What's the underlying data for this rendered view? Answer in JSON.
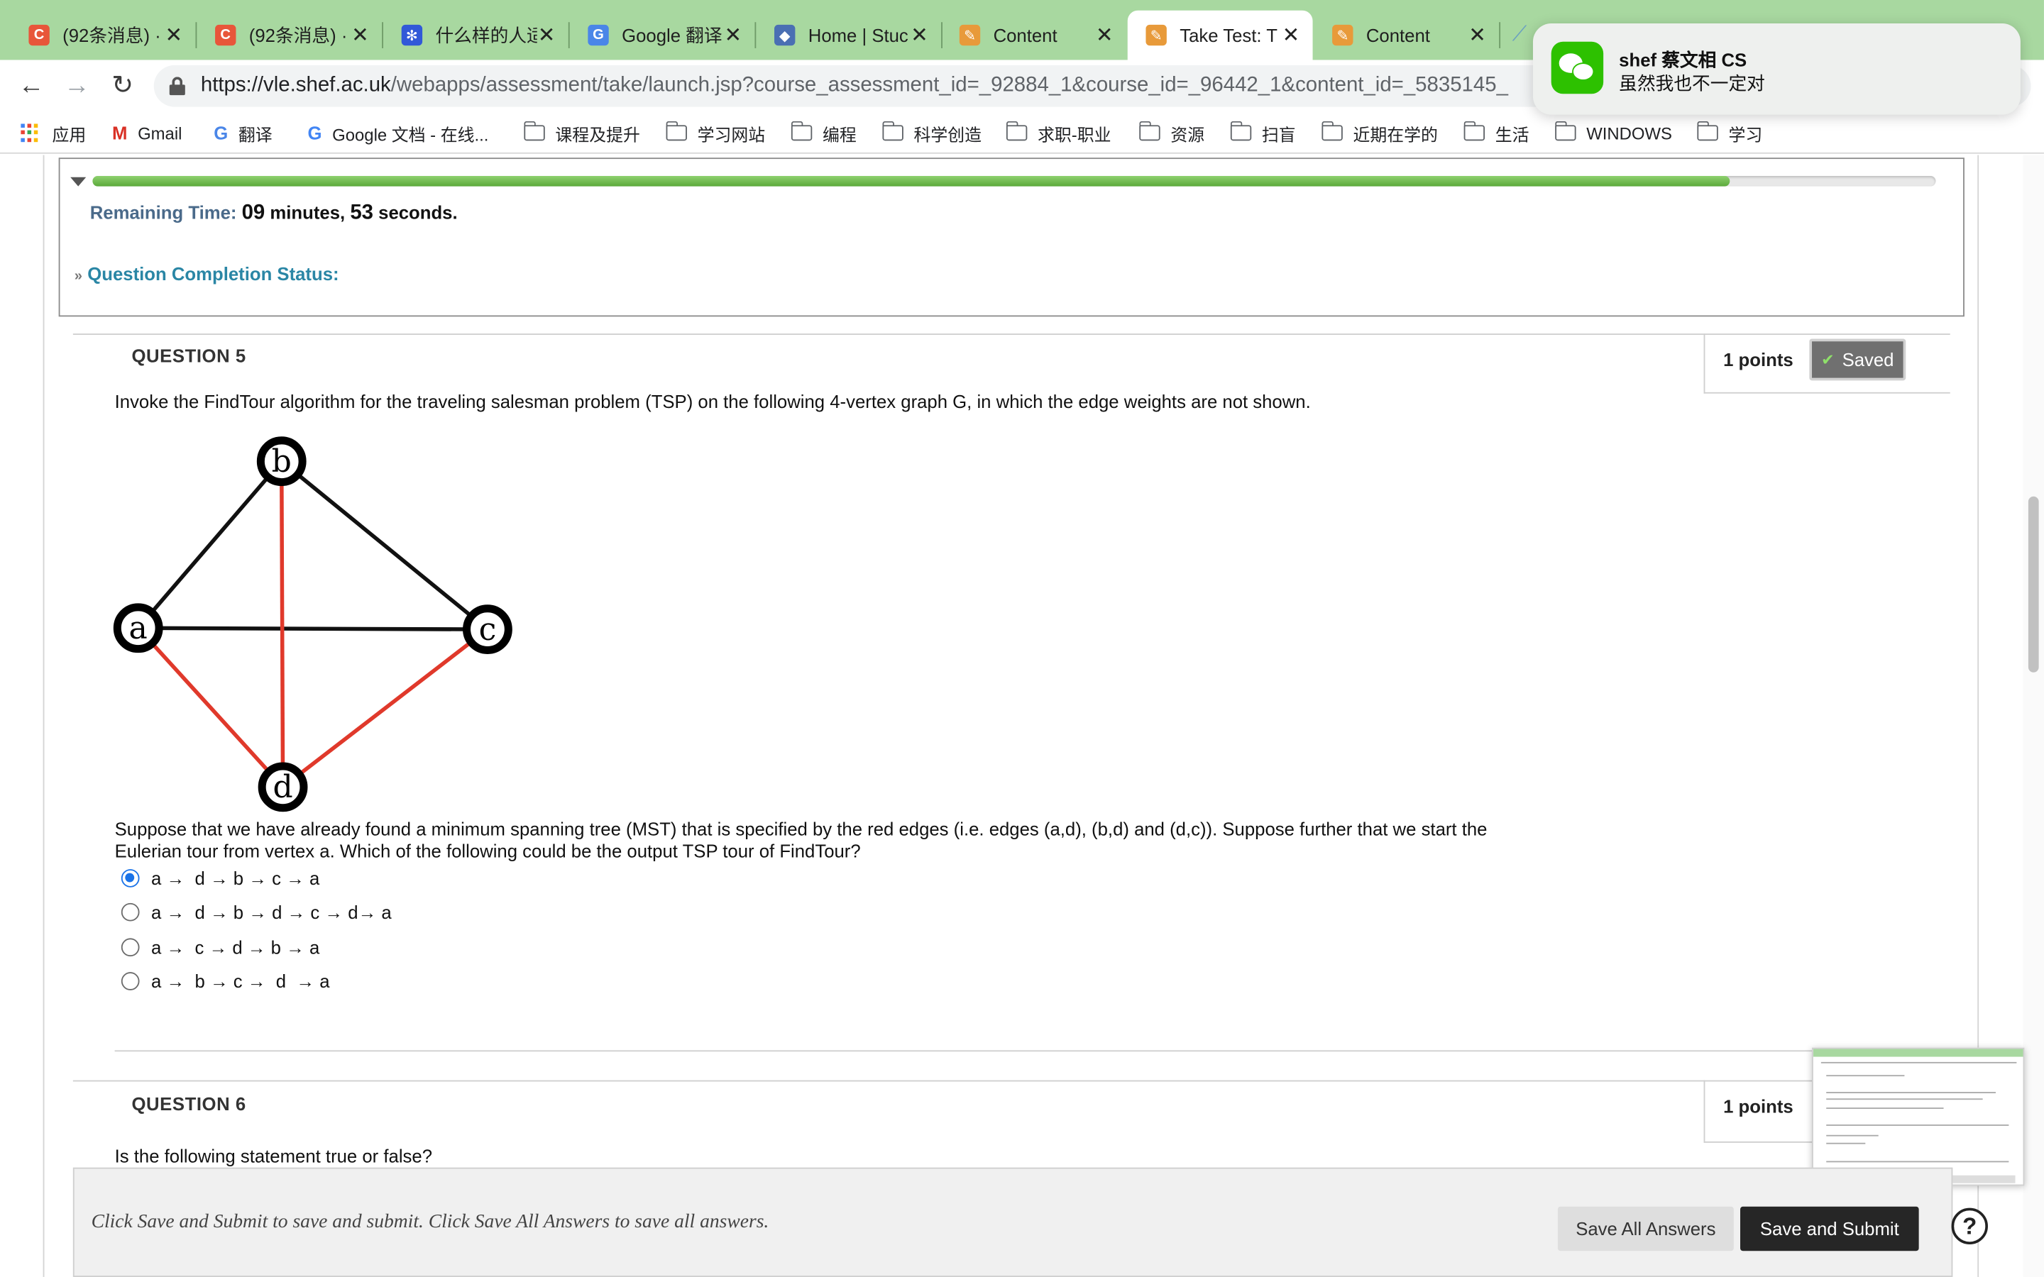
{
  "browser": {
    "tabs": [
      {
        "title": "(92条消息) ·",
        "icon": "csdn-icon",
        "icon_color": "#e8563a",
        "icon_glyph": "C"
      },
      {
        "title": "(92条消息) ·",
        "icon": "csdn-icon",
        "icon_color": "#e8563a",
        "icon_glyph": "C"
      },
      {
        "title": "什么样的人适",
        "icon": "baidu-icon",
        "icon_color": "#3159d8",
        "icon_glyph": "✻"
      },
      {
        "title": "Google 翻译",
        "icon": "google-translate-icon",
        "icon_color": "#4a86e8",
        "icon_glyph": "G"
      },
      {
        "title": "Home | Stuc",
        "icon": "university-shield-icon",
        "icon_color": "#4a6fb3",
        "icon_glyph": "◆"
      },
      {
        "title": "Content",
        "icon": "pencil-icon",
        "icon_color": "#e89a3a",
        "icon_glyph": "✎"
      },
      {
        "title": "Take Test: T",
        "icon": "pencil-icon",
        "icon_color": "#e89a3a",
        "icon_glyph": "✎"
      },
      {
        "title": "Content",
        "icon": "pencil-icon",
        "icon_color": "#e89a3a",
        "icon_glyph": "✎"
      }
    ],
    "active_tab_index": 6,
    "url_host": "https://vle.shef.ac.uk",
    "url_rest": "/webapps/assessment/take/launch.jsp?course_assessment_id=_92884_1&course_id=_96442_1&content_id=_5835145_",
    "bookmarks": [
      {
        "label": "应用",
        "type": "apps"
      },
      {
        "label": "Gmail",
        "type": "gmail"
      },
      {
        "label": "翻译",
        "type": "translate"
      },
      {
        "label": "Google 文档 - 在线...",
        "type": "google"
      },
      {
        "label": "课程及提升",
        "type": "folder"
      },
      {
        "label": "学习网站",
        "type": "folder"
      },
      {
        "label": "编程",
        "type": "folder"
      },
      {
        "label": "科学创造",
        "type": "folder"
      },
      {
        "label": "求职-职业",
        "type": "folder"
      },
      {
        "label": "资源",
        "type": "folder"
      },
      {
        "label": "扫盲",
        "type": "folder"
      },
      {
        "label": "近期在学的",
        "type": "folder"
      },
      {
        "label": "生活",
        "type": "folder"
      },
      {
        "label": "WINDOWS",
        "type": "folder"
      },
      {
        "label": "学习",
        "type": "folder"
      }
    ]
  },
  "notification": {
    "app_icon": "wechat-icon",
    "title": "shef 蔡文相 CS",
    "body": "虽然我也不一定对"
  },
  "timer": {
    "label": "Remaining Time:",
    "minutes": "09",
    "minutes_unit": " minutes, ",
    "seconds": "53",
    "seconds_unit": " seconds.",
    "progress_fraction": 0.888,
    "completion_status_label": "Question Completion Status:"
  },
  "question5": {
    "title": "QUESTION 5",
    "points": "1 points",
    "saved_label": "Saved",
    "prompt": "Invoke the FindTour algorithm for the traveling salesman problem (TSP) on the following 4-vertex graph G, in which the edge weights are not shown.",
    "graph": {
      "vertices": [
        "b",
        "a",
        "c",
        "d"
      ],
      "black_edges": [
        [
          "a",
          "b"
        ],
        [
          "b",
          "c"
        ],
        [
          "a",
          "c"
        ]
      ],
      "red_edges": [
        [
          "a",
          "d"
        ],
        [
          "b",
          "d"
        ],
        [
          "d",
          "c"
        ]
      ],
      "edge_color": "#111111",
      "mst_color": "#e0392b"
    },
    "followup": "Suppose that we have already found a minimum spanning tree (MST) that is specified by the red edges (i.e. edges (a,d), (b,d) and (d,c)). Suppose further that we start the Eulerian tour from vertex a. Which of the following could be the output TSP tour of FindTour?",
    "options": [
      {
        "label": "a →  d → b → c → a",
        "selected": true
      },
      {
        "label": "a →  d → b → d → c → d→ a",
        "selected": false
      },
      {
        "label": "a →  c → d → b → a",
        "selected": false
      },
      {
        "label": "a →  b → c →  d  → a",
        "selected": false
      }
    ]
  },
  "question6": {
    "title": "QUESTION 6",
    "points": "1 points",
    "prompt": "Is the following statement true or false?"
  },
  "footer": {
    "instructions": "Click Save and Submit to save and submit. Click Save All Answers to save all answers.",
    "save_all_label": "Save All Answers",
    "submit_label": "Save and Submit",
    "help_glyph": "?"
  },
  "colors": {
    "accent_blue": "#1a73e8",
    "tab_strip_green": "#a8d8a0",
    "progress_green": "#5ba93a",
    "submit_dark": "#262626"
  }
}
